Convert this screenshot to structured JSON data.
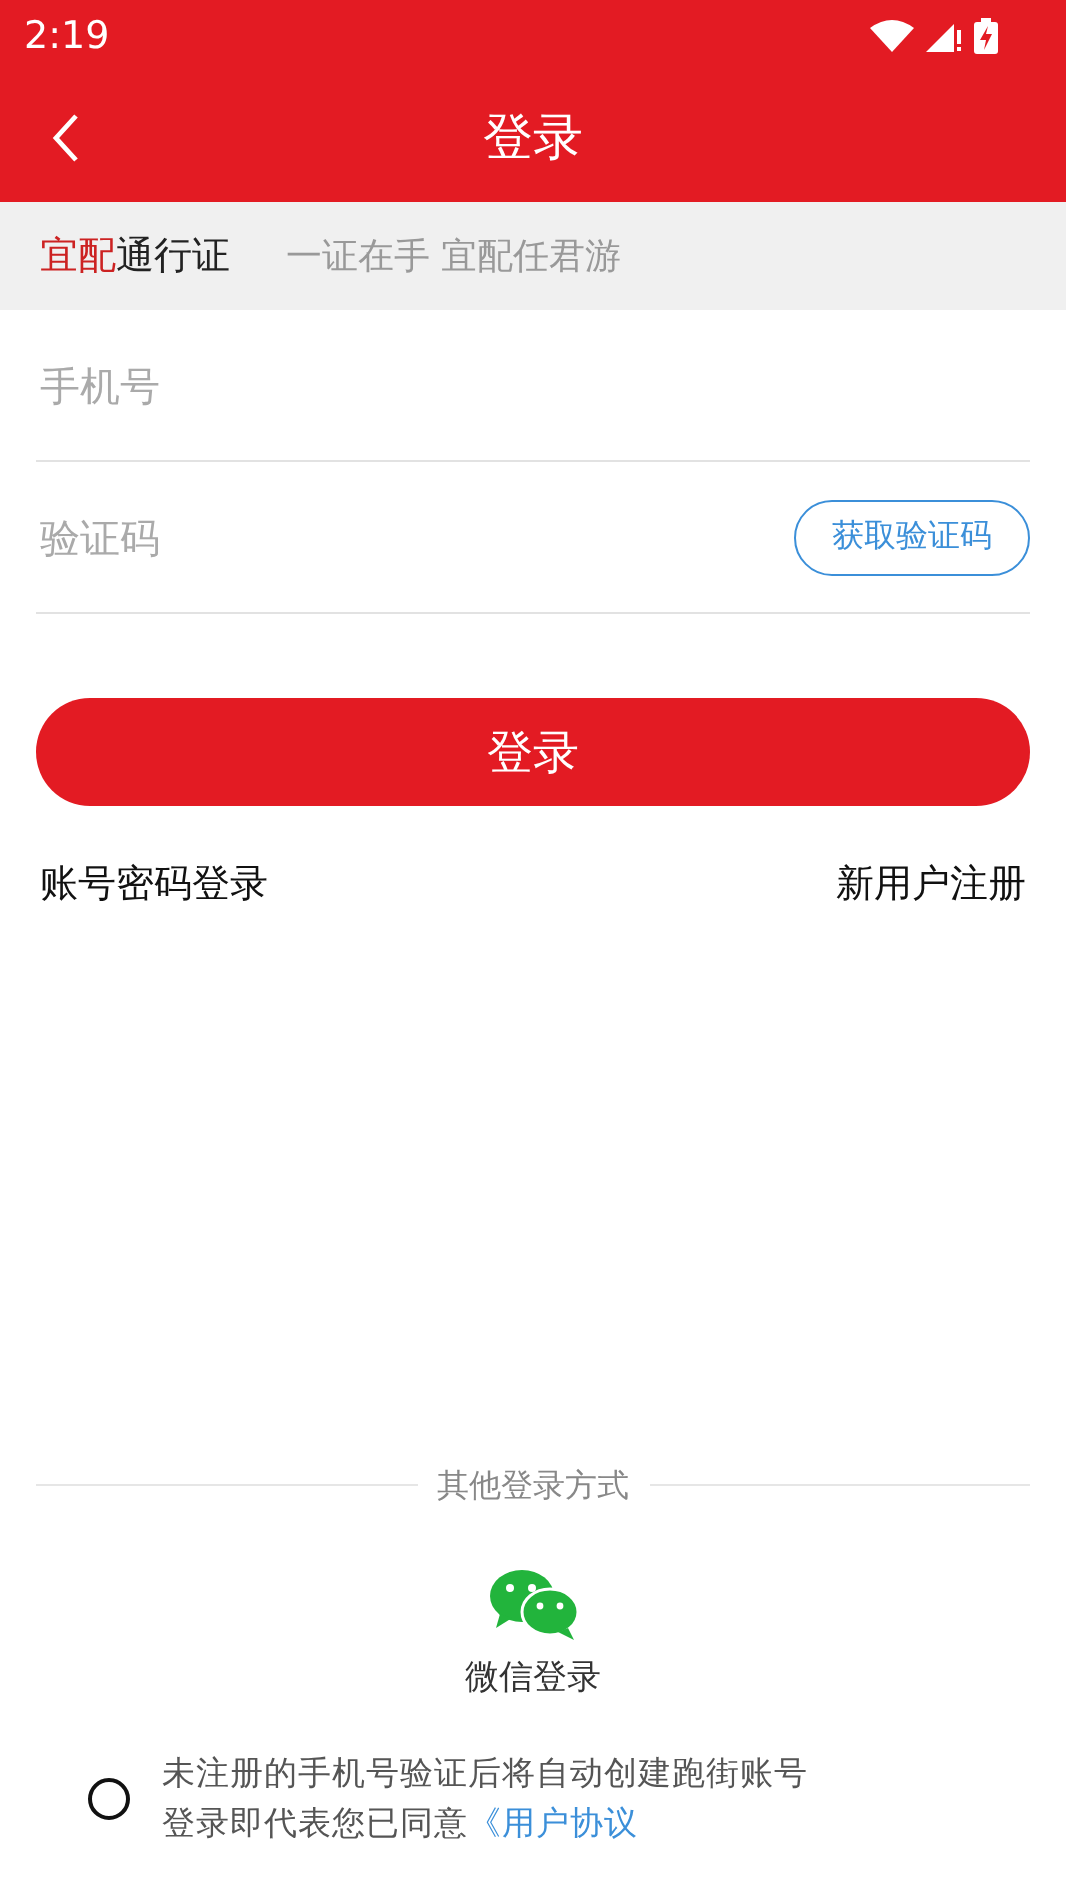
{
  "status_bar": {
    "time": "2:19"
  },
  "toolbar": {
    "title": "登录"
  },
  "banner": {
    "brand_highlight": "宜配",
    "brand_rest": "通行证",
    "slogan": "一证在手 宜配任君游"
  },
  "fields": [
    {
      "placeholder": "手机号"
    },
    {
      "placeholder": "验证码",
      "action": "获取验证码"
    }
  ],
  "login_button": "登录",
  "links": [
    "账号密码登录",
    "新用户注册"
  ],
  "other_login": {
    "label": "其他登录方式",
    "wechat_label": "微信登录"
  },
  "agreement": {
    "checked": false,
    "line_1": "未注册的手机号验证后将自动创建跑街账号",
    "line_2": "登录即代表您已同意",
    "link": "《用户协议"
  }
}
